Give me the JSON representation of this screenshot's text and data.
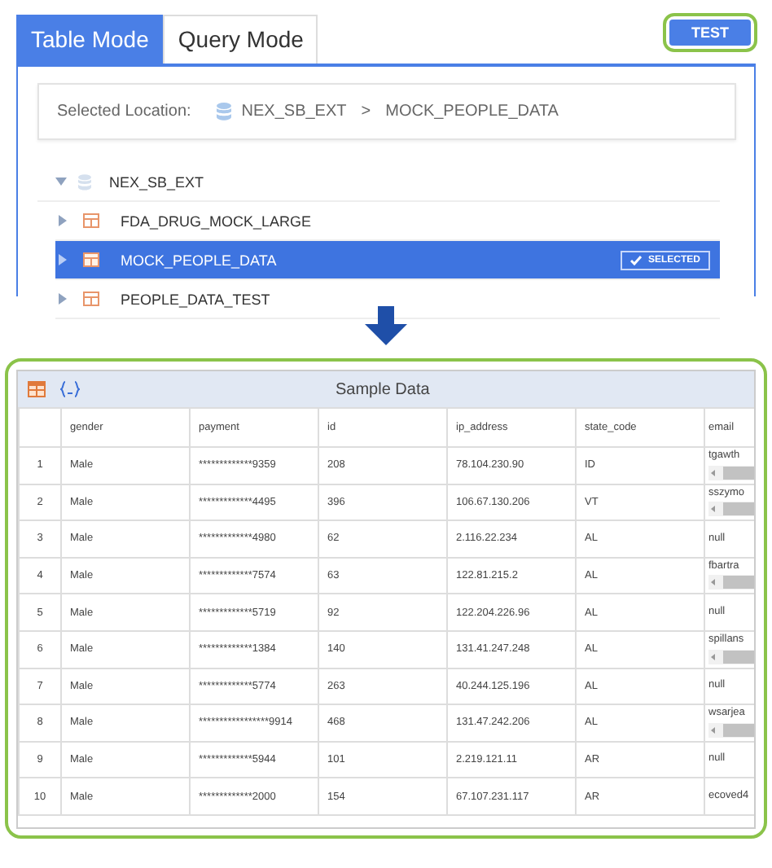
{
  "tabs": [
    {
      "label": "Table Mode",
      "selected": true
    },
    {
      "label": "Query Mode",
      "selected": false
    }
  ],
  "test_button": {
    "label": "TEST"
  },
  "location": {
    "label": "Selected Location:",
    "path": [
      "NEX_SB_EXT",
      "MOCK_PEOPLE_DATA"
    ],
    "separator": ">"
  },
  "tree": [
    {
      "label": "NEX_SB_EXT",
      "kind": "database",
      "expanded": true,
      "selected": false,
      "children": [
        {
          "label": "FDA_DRUG_MOCK_LARGE",
          "kind": "table",
          "expanded": false,
          "selected": false
        },
        {
          "label": "MOCK_PEOPLE_DATA",
          "kind": "table",
          "expanded": false,
          "selected": true,
          "badge": "SELECTED"
        },
        {
          "label": "PEOPLE_DATA_TEST",
          "kind": "table",
          "expanded": false,
          "selected": false
        }
      ]
    }
  ],
  "sample": {
    "title": "Sample Data",
    "columns": [
      "",
      "gender",
      "payment",
      "id",
      "ip_address",
      "state_code",
      "email"
    ],
    "rows": [
      {
        "cells": [
          "1",
          "Male",
          "*************9359",
          "208",
          "78.104.230.90",
          "ID"
        ],
        "email": {
          "text": "tgawth",
          "scrollbar": true
        }
      },
      {
        "cells": [
          "2",
          "Male",
          "*************4495",
          "396",
          "106.67.130.206",
          "VT"
        ],
        "email": {
          "text": "sszymo",
          "scrollbar": true
        }
      },
      {
        "cells": [
          "3",
          "Male",
          "*************4980",
          "62",
          "2.116.22.234",
          "AL"
        ],
        "email": {
          "text": "null",
          "scrollbar": false
        }
      },
      {
        "cells": [
          "4",
          "Male",
          "*************7574",
          "63",
          "122.81.215.2",
          "AL"
        ],
        "email": {
          "text": "fbartra",
          "scrollbar": true
        }
      },
      {
        "cells": [
          "5",
          "Male",
          "*************5719",
          "92",
          "122.204.226.96",
          "AL"
        ],
        "email": {
          "text": "null",
          "scrollbar": false
        }
      },
      {
        "cells": [
          "6",
          "Male",
          "*************1384",
          "140",
          "131.41.247.248",
          "AL"
        ],
        "email": {
          "text": "spillans",
          "scrollbar": true
        }
      },
      {
        "cells": [
          "7",
          "Male",
          "*************5774",
          "263",
          "40.244.125.196",
          "AL"
        ],
        "email": {
          "text": "null",
          "scrollbar": false
        }
      },
      {
        "cells": [
          "8",
          "Male",
          "*****************9914",
          "468",
          "131.47.242.206",
          "AL"
        ],
        "email": {
          "text": "wsarjea",
          "scrollbar": true
        }
      },
      {
        "cells": [
          "9",
          "Male",
          "*************5944",
          "101",
          "2.219.121.11",
          "AR"
        ],
        "email": {
          "text": "null",
          "scrollbar": false
        }
      },
      {
        "cells": [
          "10",
          "Male",
          "*************2000",
          "154",
          "67.107.231.117",
          "AR"
        ],
        "email": {
          "text": "ecoved4",
          "scrollbar": false
        }
      }
    ]
  }
}
